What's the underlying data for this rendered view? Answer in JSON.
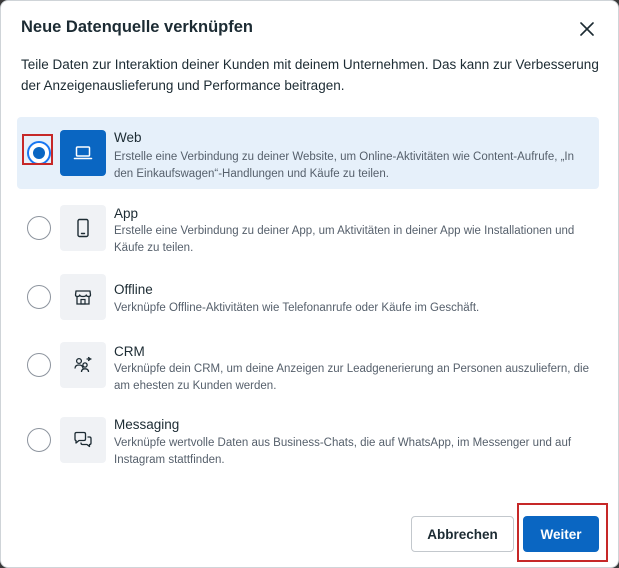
{
  "dialog": {
    "title": "Neue Datenquelle verknüpfen",
    "description": "Teile Daten zur Interaktion deiner Kunden mit deinem Unternehmen. Das kann zur Verbesserung der Anzeigenauslieferung und Performance beitragen.",
    "close_icon": "close-icon"
  },
  "options": [
    {
      "title": "Web",
      "description": "Erstelle eine Verbindung zu deiner Website, um Online-Aktivitäten wie Content-Aufrufe, „In den Einkaufswagen“-Handlungen und Käufe zu teilen.",
      "icon": "laptop-icon",
      "selected": true
    },
    {
      "title": "App",
      "description": "Erstelle eine Verbindung zu deiner App, um Aktivitäten in deiner App wie Installationen und Käufe zu teilen.",
      "icon": "phone-icon",
      "selected": false
    },
    {
      "title": "Offline",
      "description": "Verknüpfe Offline-Aktivitäten wie Telefonanrufe oder Käufe im Geschäft.",
      "icon": "store-icon",
      "selected": false
    },
    {
      "title": "CRM",
      "description": "Verknüpfe dein CRM, um deine Anzeigen zur Leadgenerierung an Personen auszuliefern, die am ehesten zu Kunden werden.",
      "icon": "crm-people-icon",
      "selected": false
    },
    {
      "title": "Messaging",
      "description": "Verknüpfe wertvolle Daten aus Business-Chats, die auf WhatsApp, im Messenger und auf Instagram stattfinden.",
      "icon": "chat-bubbles-icon",
      "selected": false
    }
  ],
  "buttons": {
    "cancel_label": "Abbrechen",
    "next_label": "Weiter"
  },
  "colors": {
    "accent": "#0a66c2",
    "selected_bg": "#e6f0fa",
    "highlight": "#c62828"
  }
}
